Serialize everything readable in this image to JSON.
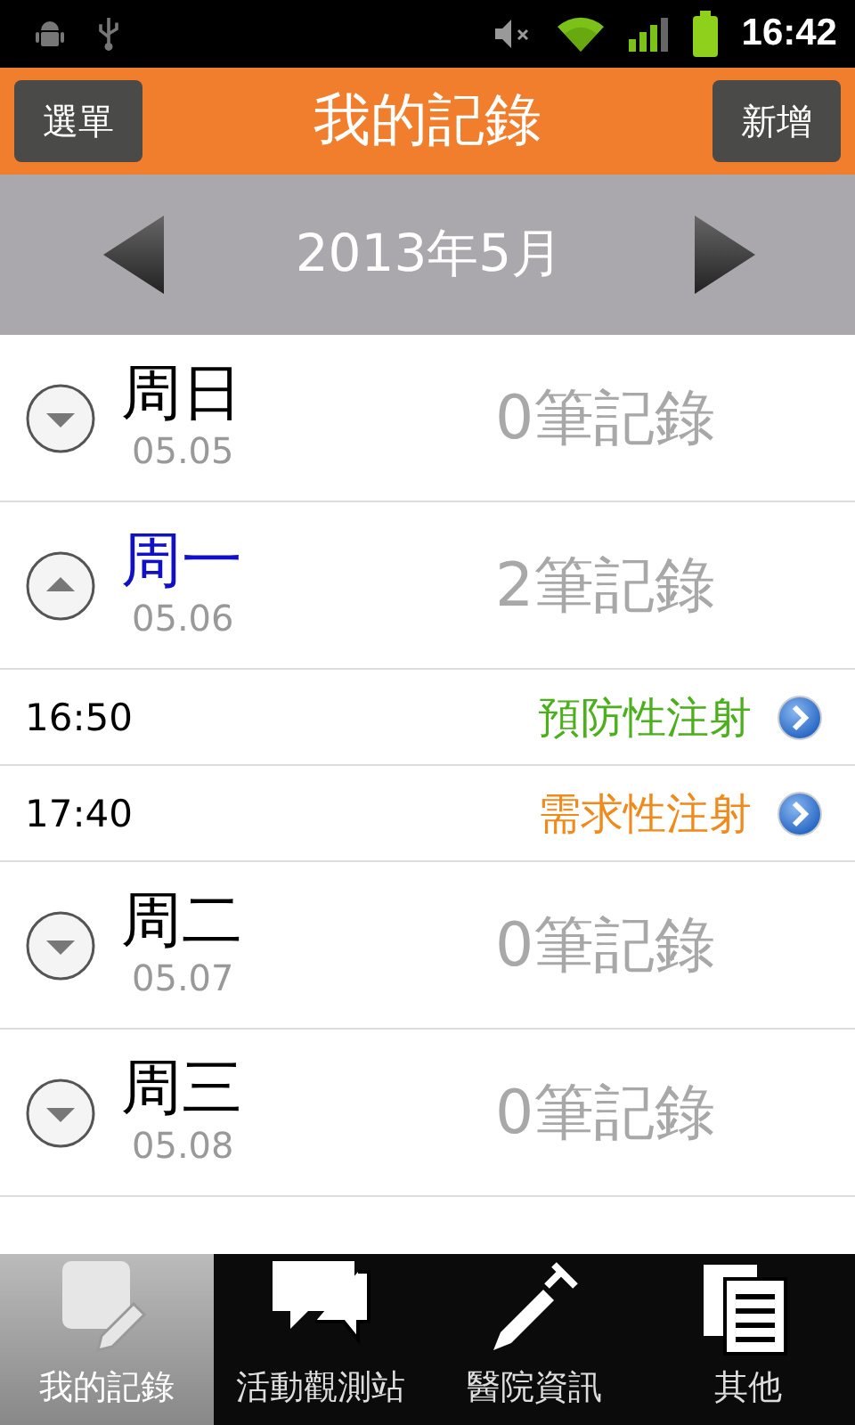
{
  "status_bar": {
    "time": "16:42"
  },
  "header": {
    "menu_button": "選單",
    "title": "我的記錄",
    "add_button": "新增"
  },
  "month_nav": {
    "label": "2013年5月"
  },
  "days": [
    {
      "day": "周日",
      "date": "05.05",
      "count": "0筆記錄",
      "expanded": false,
      "selected": false
    },
    {
      "day": "周一",
      "date": "05.06",
      "count": "2筆記錄",
      "expanded": true,
      "selected": true,
      "children": [
        {
          "time": "16:50",
          "label": "預防性注射",
          "color": "#4caf1c"
        },
        {
          "time": "17:40",
          "label": "需求性注射",
          "color": "#f08a1c"
        }
      ]
    },
    {
      "day": "周二",
      "date": "05.07",
      "count": "0筆記錄",
      "expanded": false,
      "selected": false
    },
    {
      "day": "周三",
      "date": "05.08",
      "count": "0筆記錄",
      "expanded": false,
      "selected": false
    }
  ],
  "tabs": [
    {
      "label": "我的記錄",
      "kind": "note",
      "selected": true
    },
    {
      "label": "活動觀測站",
      "kind": "chat",
      "selected": false
    },
    {
      "label": "醫院資訊",
      "kind": "syringe",
      "selected": false
    },
    {
      "label": "其他",
      "kind": "pages",
      "selected": false
    }
  ]
}
